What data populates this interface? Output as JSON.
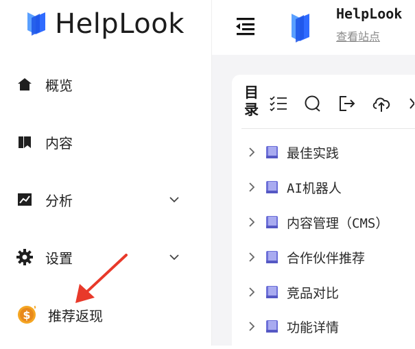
{
  "brand": {
    "name": "HelpLook"
  },
  "sidebar": {
    "items": [
      {
        "label": "概览",
        "icon": "home-icon"
      },
      {
        "label": "内容",
        "icon": "book-icon"
      },
      {
        "label": "分析",
        "icon": "chart-icon",
        "expandable": true
      },
      {
        "label": "设置",
        "icon": "gear-icon",
        "expandable": true
      }
    ],
    "referral": {
      "label": "推荐返现",
      "icon": "dollar-coin-icon"
    }
  },
  "header": {
    "site_title": "HelpLook",
    "view_site": "查看站点"
  },
  "toc": {
    "title": "目录",
    "items": [
      "最佳实践",
      "AI机器人",
      "内容管理（CMS）",
      "合作伙伴推荐",
      "竞品对比",
      "功能详情"
    ]
  },
  "colors": {
    "accent_blue": "#2f6bff",
    "annotation_red": "#e8392a",
    "coin": "#f5a623"
  }
}
